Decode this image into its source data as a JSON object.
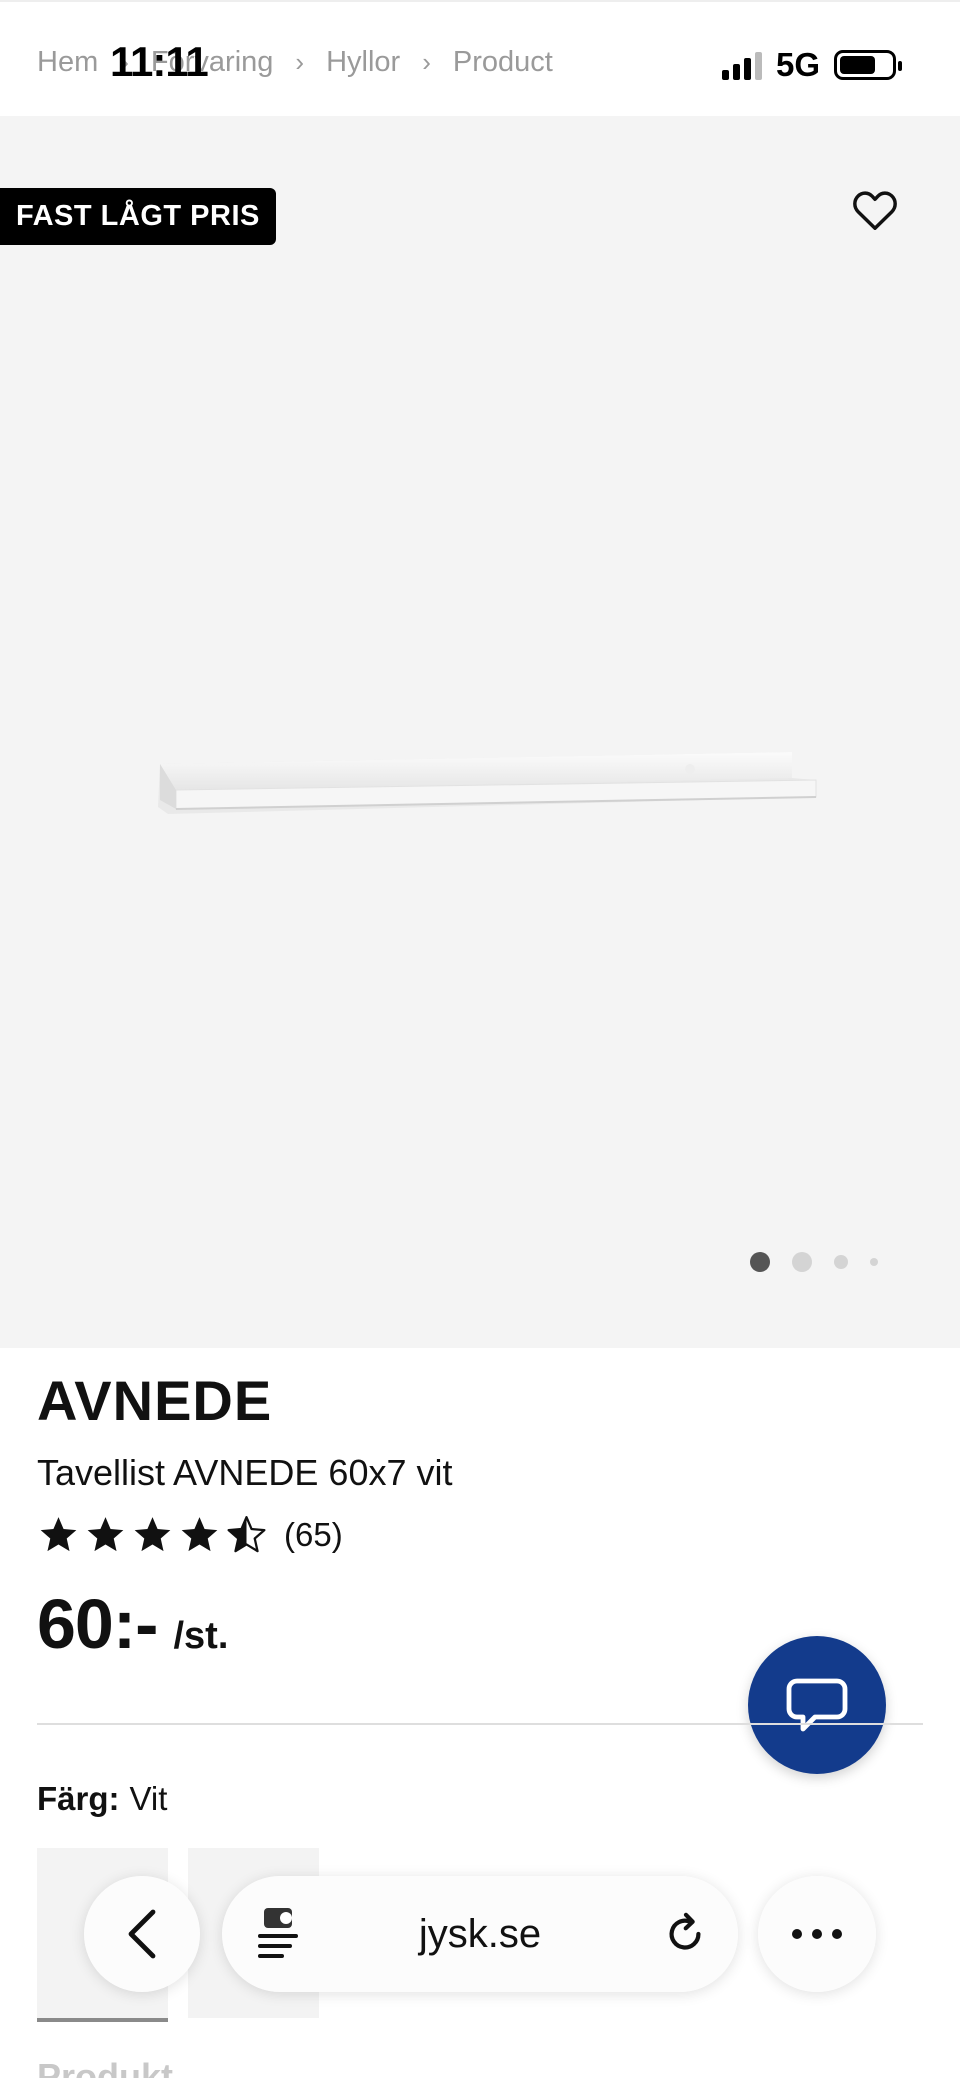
{
  "breadcrumb": {
    "items": [
      "Hem",
      "Förvaring",
      "Hyllor",
      "Product"
    ]
  },
  "status_bar": {
    "time": "11:11",
    "network": "5G",
    "signal_bars": 4
  },
  "gallery": {
    "badge": "FAST LÅGT PRIS",
    "image_count": 4,
    "active_image": 1
  },
  "product": {
    "brand": "AVNEDE",
    "name": "Tavellist AVNEDE 60x7 vit",
    "rating": 4.5,
    "rating_max": 5,
    "review_count": "(65)",
    "price": "60:-",
    "price_unit": "/st.",
    "color_label": "Färg:",
    "color_value": "Vit"
  },
  "next_section_label": "Produkt",
  "browser": {
    "url": "jysk.se"
  },
  "colors": {
    "chat_button": "#133b8c",
    "gallery_bg": "#f4f4f4",
    "badge_bg": "#000000"
  },
  "icons": {
    "favorite": "heart-outline-icon",
    "chat": "chat-bubble-icon",
    "back": "chevron-left-icon",
    "reader": "reader-mode-icon",
    "reload": "reload-icon",
    "more": "ellipsis-icon"
  }
}
